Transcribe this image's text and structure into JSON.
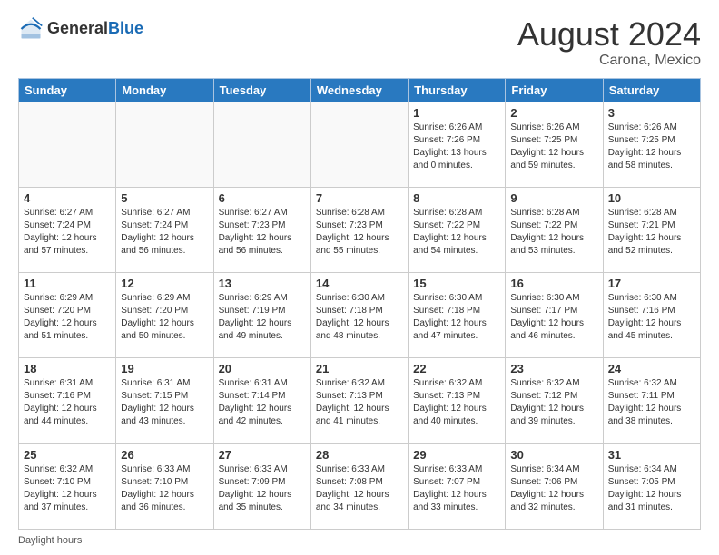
{
  "header": {
    "logo_general": "General",
    "logo_blue": "Blue",
    "main_title": "August 2024",
    "subtitle": "Carona, Mexico"
  },
  "footer": {
    "daylight_label": "Daylight hours"
  },
  "calendar": {
    "days_of_week": [
      "Sunday",
      "Monday",
      "Tuesday",
      "Wednesday",
      "Thursday",
      "Friday",
      "Saturday"
    ],
    "weeks": [
      [
        {
          "day": "",
          "info": ""
        },
        {
          "day": "",
          "info": ""
        },
        {
          "day": "",
          "info": ""
        },
        {
          "day": "",
          "info": ""
        },
        {
          "day": "1",
          "info": "Sunrise: 6:26 AM\nSunset: 7:26 PM\nDaylight: 13 hours\nand 0 minutes."
        },
        {
          "day": "2",
          "info": "Sunrise: 6:26 AM\nSunset: 7:25 PM\nDaylight: 12 hours\nand 59 minutes."
        },
        {
          "day": "3",
          "info": "Sunrise: 6:26 AM\nSunset: 7:25 PM\nDaylight: 12 hours\nand 58 minutes."
        }
      ],
      [
        {
          "day": "4",
          "info": "Sunrise: 6:27 AM\nSunset: 7:24 PM\nDaylight: 12 hours\nand 57 minutes."
        },
        {
          "day": "5",
          "info": "Sunrise: 6:27 AM\nSunset: 7:24 PM\nDaylight: 12 hours\nand 56 minutes."
        },
        {
          "day": "6",
          "info": "Sunrise: 6:27 AM\nSunset: 7:23 PM\nDaylight: 12 hours\nand 56 minutes."
        },
        {
          "day": "7",
          "info": "Sunrise: 6:28 AM\nSunset: 7:23 PM\nDaylight: 12 hours\nand 55 minutes."
        },
        {
          "day": "8",
          "info": "Sunrise: 6:28 AM\nSunset: 7:22 PM\nDaylight: 12 hours\nand 54 minutes."
        },
        {
          "day": "9",
          "info": "Sunrise: 6:28 AM\nSunset: 7:22 PM\nDaylight: 12 hours\nand 53 minutes."
        },
        {
          "day": "10",
          "info": "Sunrise: 6:28 AM\nSunset: 7:21 PM\nDaylight: 12 hours\nand 52 minutes."
        }
      ],
      [
        {
          "day": "11",
          "info": "Sunrise: 6:29 AM\nSunset: 7:20 PM\nDaylight: 12 hours\nand 51 minutes."
        },
        {
          "day": "12",
          "info": "Sunrise: 6:29 AM\nSunset: 7:20 PM\nDaylight: 12 hours\nand 50 minutes."
        },
        {
          "day": "13",
          "info": "Sunrise: 6:29 AM\nSunset: 7:19 PM\nDaylight: 12 hours\nand 49 minutes."
        },
        {
          "day": "14",
          "info": "Sunrise: 6:30 AM\nSunset: 7:18 PM\nDaylight: 12 hours\nand 48 minutes."
        },
        {
          "day": "15",
          "info": "Sunrise: 6:30 AM\nSunset: 7:18 PM\nDaylight: 12 hours\nand 47 minutes."
        },
        {
          "day": "16",
          "info": "Sunrise: 6:30 AM\nSunset: 7:17 PM\nDaylight: 12 hours\nand 46 minutes."
        },
        {
          "day": "17",
          "info": "Sunrise: 6:30 AM\nSunset: 7:16 PM\nDaylight: 12 hours\nand 45 minutes."
        }
      ],
      [
        {
          "day": "18",
          "info": "Sunrise: 6:31 AM\nSunset: 7:16 PM\nDaylight: 12 hours\nand 44 minutes."
        },
        {
          "day": "19",
          "info": "Sunrise: 6:31 AM\nSunset: 7:15 PM\nDaylight: 12 hours\nand 43 minutes."
        },
        {
          "day": "20",
          "info": "Sunrise: 6:31 AM\nSunset: 7:14 PM\nDaylight: 12 hours\nand 42 minutes."
        },
        {
          "day": "21",
          "info": "Sunrise: 6:32 AM\nSunset: 7:13 PM\nDaylight: 12 hours\nand 41 minutes."
        },
        {
          "day": "22",
          "info": "Sunrise: 6:32 AM\nSunset: 7:13 PM\nDaylight: 12 hours\nand 40 minutes."
        },
        {
          "day": "23",
          "info": "Sunrise: 6:32 AM\nSunset: 7:12 PM\nDaylight: 12 hours\nand 39 minutes."
        },
        {
          "day": "24",
          "info": "Sunrise: 6:32 AM\nSunset: 7:11 PM\nDaylight: 12 hours\nand 38 minutes."
        }
      ],
      [
        {
          "day": "25",
          "info": "Sunrise: 6:32 AM\nSunset: 7:10 PM\nDaylight: 12 hours\nand 37 minutes."
        },
        {
          "day": "26",
          "info": "Sunrise: 6:33 AM\nSunset: 7:10 PM\nDaylight: 12 hours\nand 36 minutes."
        },
        {
          "day": "27",
          "info": "Sunrise: 6:33 AM\nSunset: 7:09 PM\nDaylight: 12 hours\nand 35 minutes."
        },
        {
          "day": "28",
          "info": "Sunrise: 6:33 AM\nSunset: 7:08 PM\nDaylight: 12 hours\nand 34 minutes."
        },
        {
          "day": "29",
          "info": "Sunrise: 6:33 AM\nSunset: 7:07 PM\nDaylight: 12 hours\nand 33 minutes."
        },
        {
          "day": "30",
          "info": "Sunrise: 6:34 AM\nSunset: 7:06 PM\nDaylight: 12 hours\nand 32 minutes."
        },
        {
          "day": "31",
          "info": "Sunrise: 6:34 AM\nSunset: 7:05 PM\nDaylight: 12 hours\nand 31 minutes."
        }
      ]
    ]
  }
}
